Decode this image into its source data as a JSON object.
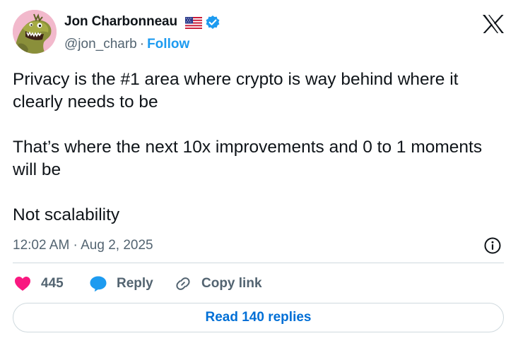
{
  "author": {
    "name": "Jon Charbonneau",
    "handle": "@jon_charb",
    "separator": "·",
    "follow_label": "Follow",
    "flag_icon": "us-flag-icon",
    "verified_icon": "verified-badge-icon"
  },
  "platform": {
    "logo_icon": "x-logo-icon"
  },
  "tweet": {
    "paragraphs": [
      "Privacy is the #1 area where crypto is way behind where it clearly needs to be",
      "That’s where the next 10x improvements and 0 to 1 moments will be",
      "Not scalability"
    ],
    "timestamp": "12:02 AM · Aug 2, 2025"
  },
  "actions": {
    "like_count": "445",
    "reply_label": "Reply",
    "copy_link_label": "Copy link"
  },
  "read_replies_label": "Read 140 replies",
  "colors": {
    "like": "#f91880",
    "reply": "#1d9bf0",
    "link": "#006fd6",
    "muted": "#536471",
    "text": "#0f1419"
  }
}
